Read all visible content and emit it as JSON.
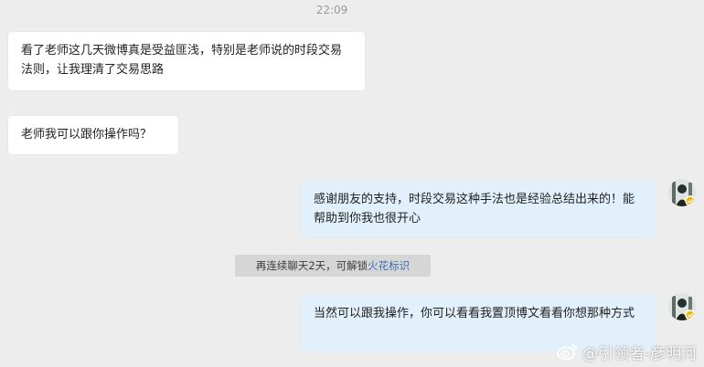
{
  "chat": {
    "timestamp": "22:09",
    "messages": [
      {
        "direction": "incoming",
        "text": "看了老师这几天微博真是受益匪浅，特别是老师说的时段交易法则，让我理清了交易思路"
      },
      {
        "direction": "incoming",
        "text": "老师我可以跟你操作吗？"
      },
      {
        "direction": "outgoing",
        "text": "感谢朋友的支持，时段交易这种手法也是经验总结出来的！能帮助到你我也很开心"
      },
      {
        "direction": "outgoing",
        "text": "当然可以跟我操作，你可以看看我置顶博文看看你想那种方式"
      }
    ],
    "streak_notice": {
      "text": "再连续聊天2天，可解锁",
      "link": "火花标识"
    }
  },
  "watermark": {
    "icon": "weibo-icon",
    "text": "@引领者-彦明河"
  },
  "colors": {
    "background": "#ededed",
    "incoming_bubble": "#ffffff",
    "outgoing_bubble": "#e2f0fb",
    "link": "#3c6fb0"
  }
}
